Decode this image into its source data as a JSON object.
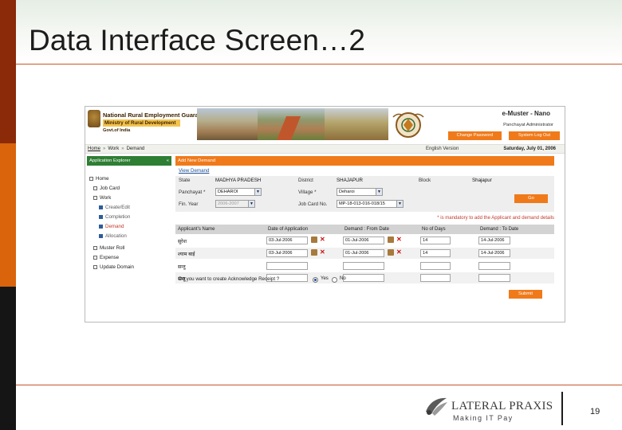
{
  "slide": {
    "title": "Data Interface Screen…2",
    "page_number": "19"
  },
  "footer": {
    "company": "LATERAL PRAXIS",
    "tagline": "Making IT Pay"
  },
  "app": {
    "header": {
      "title": "National Rural Employment Guarantee Act - 2005",
      "ministry": "Ministry of Rural Development",
      "govt": "Govt.of India",
      "product": "e-Muster - Nano",
      "user_role": "Panchayat Administrator",
      "change_password": "Change Password",
      "logout": "System Log Out"
    },
    "breadcrumb": {
      "home": "Home",
      "work": "Work",
      "demand": "Demand",
      "separator": "»"
    },
    "language": "English Version",
    "date": "Saturday, July 01, 2006",
    "sidebar": {
      "header": "Application Explorer",
      "collapse_icon": "«",
      "items": [
        {
          "label": "Home"
        },
        {
          "label": "Job Card"
        },
        {
          "label": "Work"
        },
        {
          "label": "Create/Edit"
        },
        {
          "label": "Completion"
        },
        {
          "label": "Demand"
        },
        {
          "label": "Allocation"
        },
        {
          "label": "Muster Roll"
        },
        {
          "label": "Expense"
        },
        {
          "label": "Update Domain"
        }
      ]
    },
    "form": {
      "panel_title": "Add New Demand",
      "view_link": "View Demand",
      "state_label": "State",
      "state_value": "MADHYA PRADESH",
      "district_label": "District",
      "district_value": "SHAJAPUR",
      "block_label": "Block",
      "block_value": "Shajapur",
      "panchayat_label": "Panchayat *",
      "panchayat_value": "DEHAROI",
      "village_label": "Village *",
      "village_value": "Deharoi",
      "finyear_label": "Fin. Year",
      "finyear_value": "2006-2007",
      "jobcard_label": "Job Card No.",
      "jobcard_value": "MP-18-013-016-018/15",
      "go_label": "Go",
      "mandatory_note": "* is mandatory to add the Applicant and demand details"
    },
    "table": {
      "headers": [
        "Applicant's Name",
        "Date of Application",
        "Demand : From Date",
        "No of Days",
        "Demand : To Date"
      ],
      "rows": [
        {
          "name": "सुरेश",
          "date_app": "03-Jul-2006",
          "from": "01-Jul-2006",
          "days": "14",
          "to": "14-Jul-2006"
        },
        {
          "name": "श्याम बाई",
          "date_app": "03-Jul-2006",
          "from": "01-Jul-2006",
          "days": "14",
          "to": "14-Jul-2006"
        },
        {
          "name": "सन्तु",
          "date_app": "",
          "from": "",
          "days": "",
          "to": ""
        },
        {
          "name": "सन्तु",
          "date_app": "",
          "from": "",
          "days": "",
          "to": ""
        }
      ]
    },
    "ack": {
      "question": "Do you want to create Acknowledge Receipt ?",
      "yes": "Yes",
      "no": "No",
      "selected": "Yes"
    },
    "submit_label": "Submit"
  },
  "colors": {
    "accent_orange": "#f07a1a",
    "sidebar_green": "#2e7e34",
    "band_dark": "#8b2a08",
    "band_orange": "#d9640c",
    "band_black": "#151515",
    "rule": "#c3582a"
  }
}
